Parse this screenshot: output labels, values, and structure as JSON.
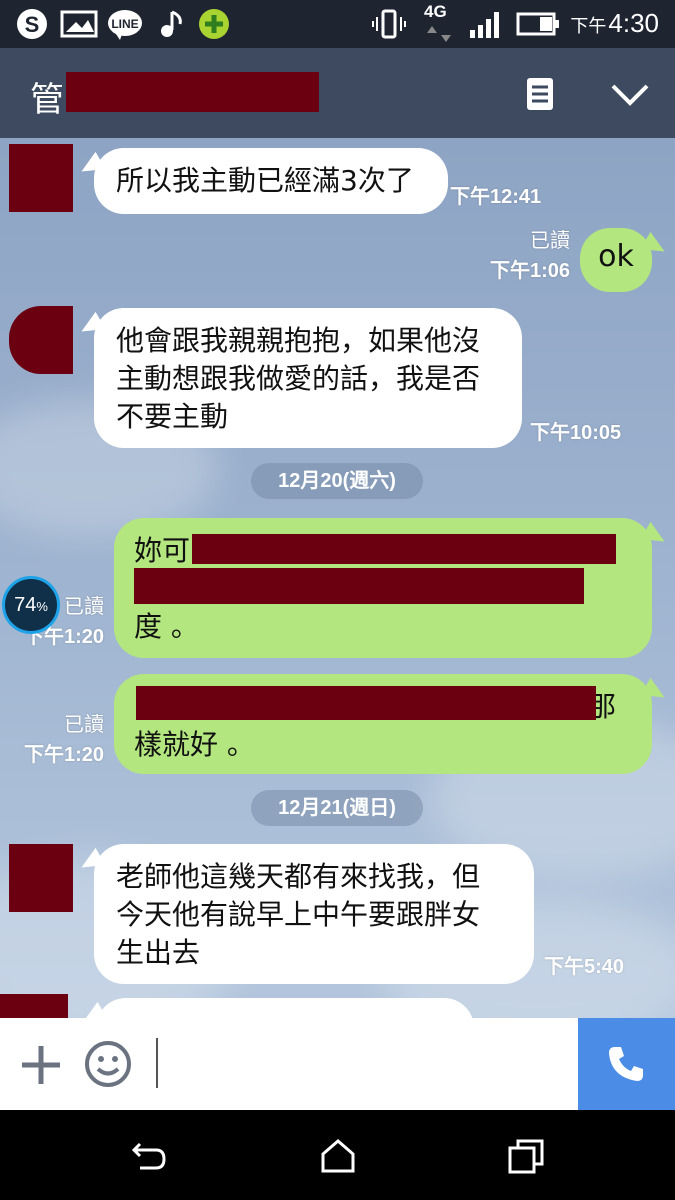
{
  "status_bar": {
    "time_prefix": "下午",
    "time": "4:30",
    "network": "4G",
    "icons": [
      "skype-icon",
      "gallery-icon",
      "line-icon",
      "music-icon",
      "plus-app-icon",
      "vibrate-icon",
      "signal-icon",
      "battery-icon"
    ]
  },
  "header": {
    "title_visible": "管",
    "menu_icon": "document-icon",
    "collapse_icon": "chevron-down-icon"
  },
  "messages": [
    {
      "side": "left",
      "text": "所以我主動已經滿3次了",
      "time": "下午12:41"
    },
    {
      "side": "right",
      "text": "ok",
      "read": "已讀",
      "time": "下午1:06"
    },
    {
      "side": "left",
      "lines": [
        "他會跟我親親抱抱，如果他沒",
        "主動想跟我做愛的話，我是否",
        "不要主動"
      ],
      "time": "下午10:05"
    },
    {
      "side": "right",
      "lines": [
        "妳可",
        "",
        "度 。"
      ],
      "read": "已讀",
      "time": "下午1:20"
    },
    {
      "side": "right",
      "lines": [
        "那",
        "樣就好 。"
      ],
      "read": "已讀",
      "time": "下午1:20"
    },
    {
      "side": "left",
      "lines": [
        "老師他這幾天都有來找我，但",
        "今天他有說早上中午要跟胖女",
        "生出去"
      ],
      "time": "下午5:40"
    }
  ],
  "dates": [
    "12月20(週六)",
    "12月21(週日)"
  ],
  "overlay": {
    "percent": "74",
    "unit": "%"
  },
  "input_bar": {
    "plus_icon": "plus-icon",
    "sticker_icon": "smiley-icon",
    "call_icon": "phone-icon"
  },
  "nav_bar": {
    "back_icon": "back-icon",
    "home_icon": "home-icon",
    "recents_icon": "recents-icon"
  }
}
